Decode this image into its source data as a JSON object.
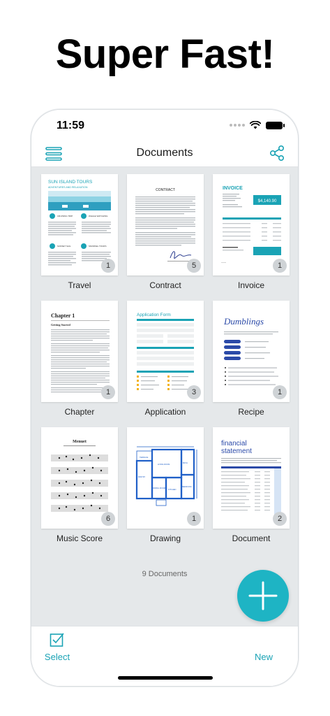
{
  "headline": "Super Fast!",
  "status_bar": {
    "time": "11:59"
  },
  "nav": {
    "title": "Documents"
  },
  "documents": [
    {
      "name": "Travel",
      "pages": "1",
      "preview": {
        "title": "SUN ISLAND TOURS",
        "subtitle": "ADVENTURES AND RELAXATION",
        "sections": [
          "CRUISING TRIP",
          "WHALE WATCHING",
          "SUNSET SAIL",
          "SNORKEL TOURS"
        ]
      }
    },
    {
      "name": "Contract",
      "pages": "5",
      "preview": {
        "title": "CONTRACT"
      }
    },
    {
      "name": "Invoice",
      "pages": "1",
      "preview": {
        "title": "INVOICE",
        "amount": "$4,140.90"
      }
    },
    {
      "name": "Chapter",
      "pages": "1",
      "preview": {
        "title": "Chapter 1",
        "subtitle": "Getting Started"
      }
    },
    {
      "name": "Application",
      "pages": "3",
      "preview": {
        "title": "Application Form"
      }
    },
    {
      "name": "Recipe",
      "pages": "1",
      "preview": {
        "title": "Dumblings"
      }
    },
    {
      "name": "Music Score",
      "pages": "6",
      "preview": {
        "title": "Menuet"
      }
    },
    {
      "name": "Drawing",
      "pages": "1",
      "preview": {
        "rooms": [
          "TERRACE",
          "LIVING ROOM",
          "PANTRY",
          "KITCHEN",
          "BATH",
          "BEDROOM",
          "DINING ROOM"
        ]
      }
    },
    {
      "name": "Document",
      "pages": "2",
      "preview": {
        "title_line1": "financial",
        "title_line2": "statement"
      }
    }
  ],
  "footer": {
    "count": "9 Documents"
  },
  "tab_bar": {
    "select_label": "Select",
    "new_label": "New"
  },
  "colors": {
    "accent": "#1eb4c4",
    "background": "#e5e8ea"
  }
}
